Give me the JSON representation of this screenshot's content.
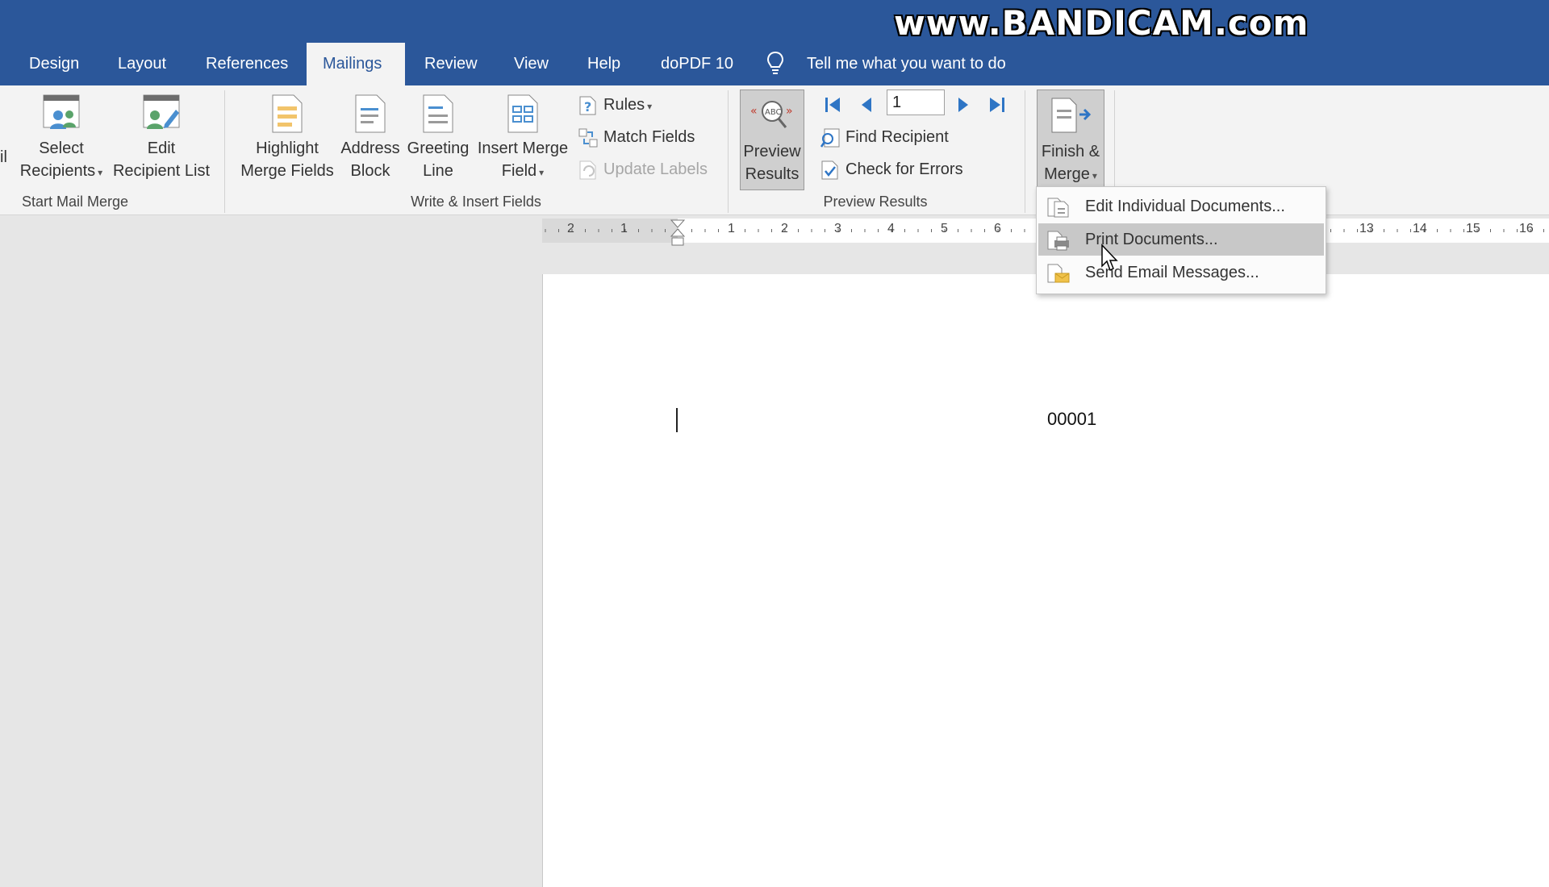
{
  "watermark": "www.BANDICAM.com",
  "tabs": [
    {
      "label": "Design"
    },
    {
      "label": "Layout"
    },
    {
      "label": "References"
    },
    {
      "label": "Mailings",
      "active": true
    },
    {
      "label": "Review"
    },
    {
      "label": "View"
    },
    {
      "label": "Help"
    },
    {
      "label": "doPDF 10"
    }
  ],
  "tell_me": "Tell me what you want to do",
  "ribbon": {
    "start_mail_merge": {
      "partial_label": "il",
      "select_recipients": [
        "Select",
        "Recipients"
      ],
      "edit_recipient_list": [
        "Edit",
        "Recipient List"
      ],
      "group_label": "Start Mail Merge"
    },
    "write_insert": {
      "highlight": [
        "Highlight",
        "Merge Fields"
      ],
      "address_block": [
        "Address",
        "Block"
      ],
      "greeting_line": [
        "Greeting",
        "Line"
      ],
      "insert_merge_field": [
        "Insert Merge",
        "Field"
      ],
      "rules": "Rules",
      "match_fields": "Match Fields",
      "update_labels": "Update Labels",
      "group_label": "Write & Insert Fields"
    },
    "preview_results": {
      "preview": [
        "Preview",
        "Results"
      ],
      "record_number": "1",
      "find_recipient": "Find Recipient",
      "check_errors": "Check for Errors",
      "group_label": "Preview Results"
    },
    "finish": {
      "finish_merge": [
        "Finish &",
        "Merge"
      ]
    }
  },
  "finish_menu": [
    {
      "label": "Edit Individual Documents...",
      "icon": "edit-documents-icon"
    },
    {
      "label": "Print Documents...",
      "icon": "print-documents-icon",
      "hovered": true
    },
    {
      "label": "Send Email Messages...",
      "icon": "email-messages-icon"
    }
  ],
  "ruler_numbers": [
    "2",
    "1",
    "1",
    "2",
    "3",
    "4",
    "5",
    "6",
    "13",
    "14",
    "15",
    "16"
  ],
  "document": {
    "field_value": "00001"
  },
  "colors": {
    "title_bar": "#2b579a",
    "ribbon": "#f3f3f3",
    "hover": "#c8c8c8"
  }
}
